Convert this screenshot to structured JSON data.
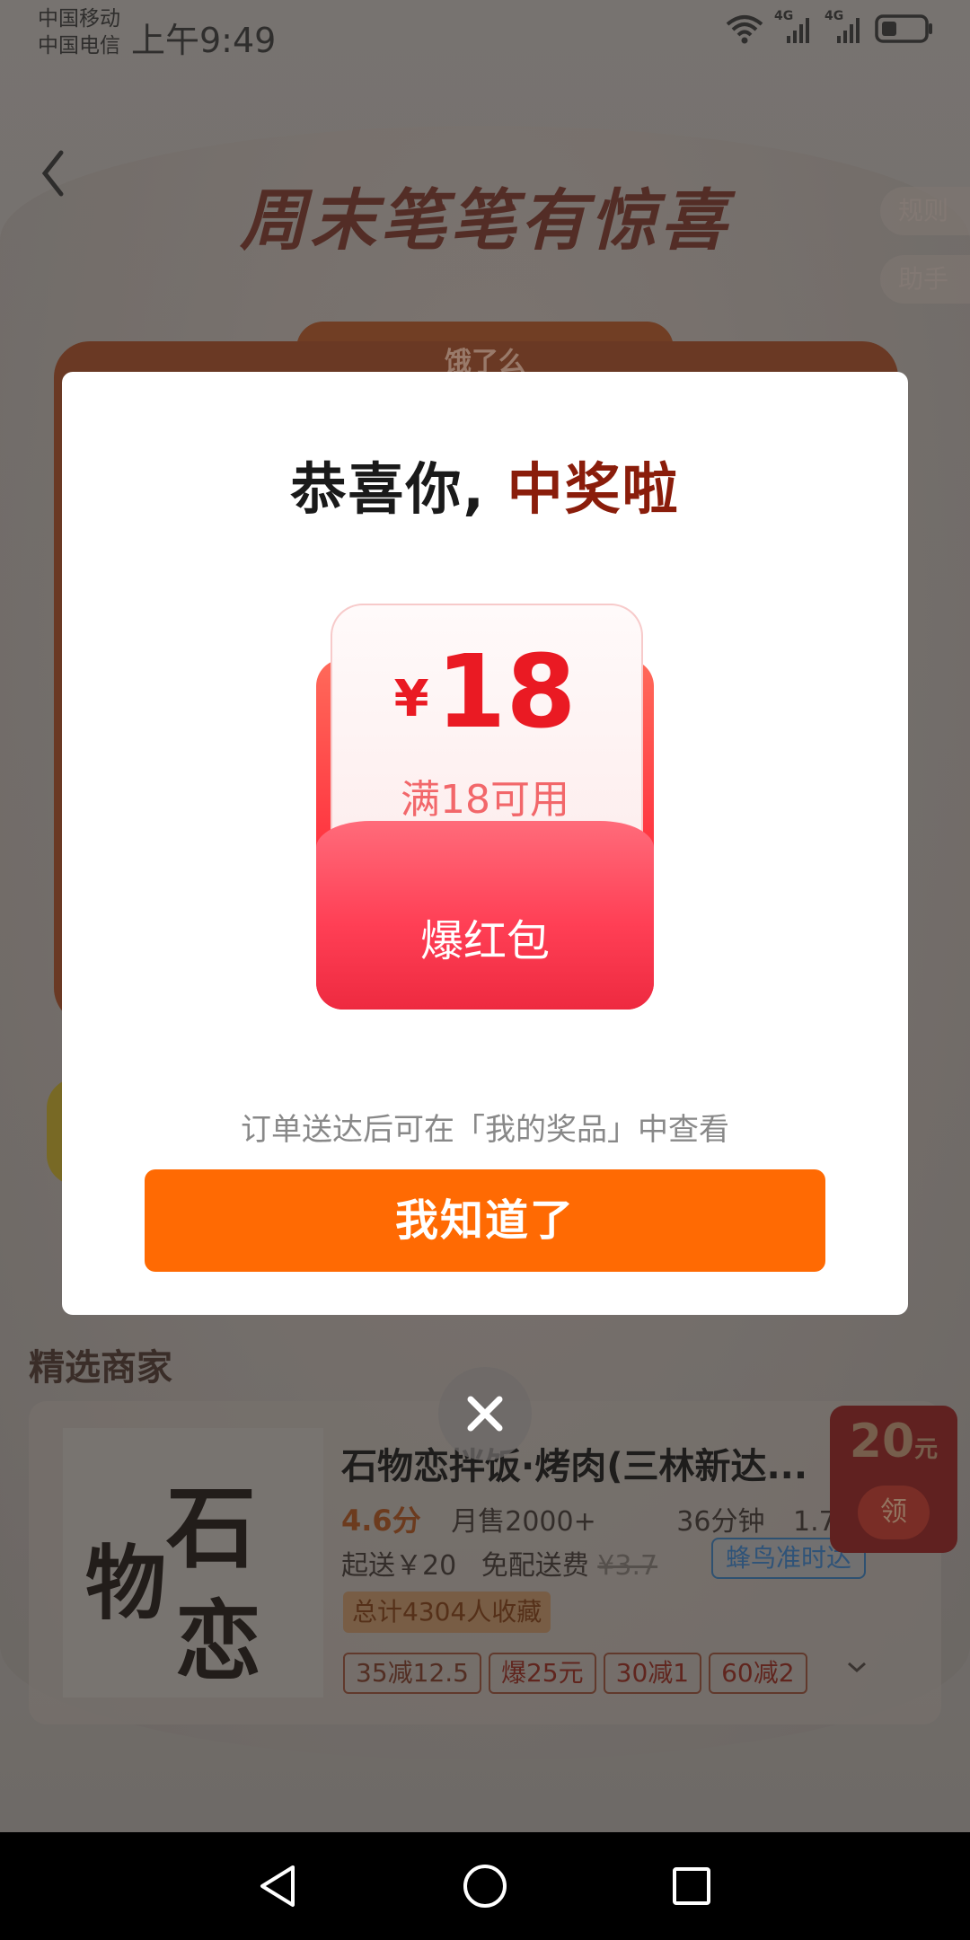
{
  "status_bar": {
    "carrier1": "中国移动",
    "carrier2": "中国电信",
    "time": "上午9:49",
    "net1": "4G",
    "net2": "4G"
  },
  "background": {
    "title": "周末笔笔有惊喜",
    "rule_chip": "规则",
    "helper_chip": "助手",
    "brand_label": "饿了么",
    "section_title": "精选商家",
    "store": {
      "name": "石物恋拌饭·烤肉(三林新达...",
      "logo_text_1": "石",
      "logo_text_2": "物",
      "logo_text_3": "恋",
      "rating": "4.6分",
      "monthly_sales": "月售2000+",
      "eta": "36分钟",
      "distance": "1.75",
      "min_order": "起送￥20",
      "delivery": "免配送费",
      "original_fee": "¥3.7",
      "delivery_badge": "蜂鸟准时达",
      "favorites": "总计4304人收藏",
      "tags": [
        "35减12.5",
        "爆25元",
        "30减1",
        "60减2"
      ]
    },
    "float_coupon": {
      "amount": "20",
      "unit": "元",
      "action": "领"
    }
  },
  "modal": {
    "title_part1": "恭喜你,",
    "title_part2": "中奖啦",
    "coupon": {
      "currency": "¥",
      "amount": "18",
      "condition": "满18可用",
      "name": "爆红包"
    },
    "hint": "订单送达后可在「我的奖品」中查看",
    "ok_button": "我知道了"
  },
  "colors": {
    "accent_orange": "#ff6a03",
    "coupon_red": "#ea1a23",
    "title_dark_red": "#8a1d0b"
  }
}
